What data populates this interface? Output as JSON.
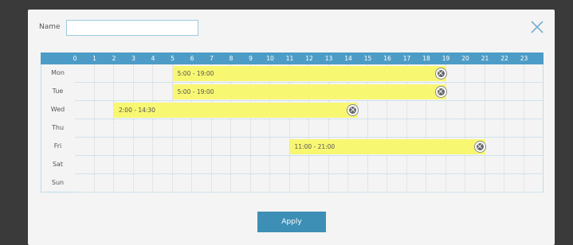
{
  "dialog": {
    "name_label": "Name",
    "name_value": "",
    "close_symbol": "×",
    "apply_label": "Apply"
  },
  "hours": [
    "0",
    "1",
    "2",
    "3",
    "4",
    "5",
    "6",
    "7",
    "8",
    "9",
    "10",
    "11",
    "12",
    "13",
    "14",
    "15",
    "16",
    "17",
    "18",
    "19",
    "20",
    "21",
    "22",
    "23"
  ],
  "days": [
    "Mon",
    "Tue",
    "Wed",
    "Thu",
    "Fri",
    "Sat",
    "Sun"
  ],
  "schedules": [
    {
      "day": "Mon",
      "start": 5,
      "end": 19,
      "label": "5:00 - 19:00"
    },
    {
      "day": "Tue",
      "start": 5,
      "end": 19,
      "label": "5:00 - 19:00"
    },
    {
      "day": "Wed",
      "start": 2,
      "end": 14.5,
      "label": "2:00 - 14:30"
    },
    {
      "day": "Fri",
      "start": 11,
      "end": 21,
      "label": "11:00 - 21:00"
    }
  ],
  "colors": {
    "header": "#4d9cc7",
    "bar": "#f8f772",
    "apply": "#3d8fb5",
    "input_border": "#9ccbe0"
  },
  "icons": {
    "close": "close-icon",
    "remove_schedule": "remove-icon"
  }
}
